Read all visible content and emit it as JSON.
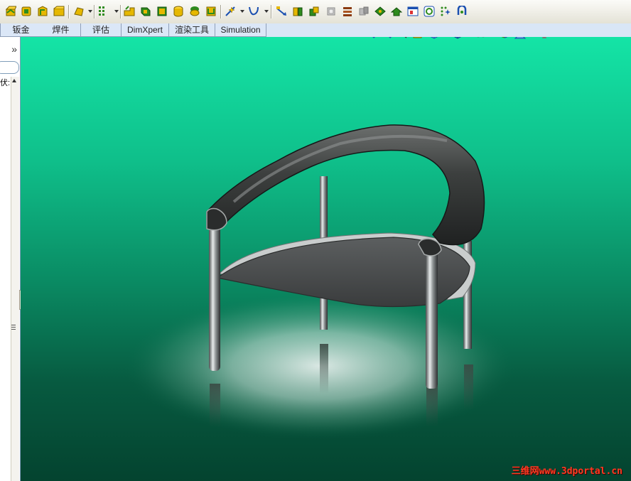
{
  "toolbar": {
    "icons": [
      {
        "name": "extruded-boss-icon",
        "color": "#e6b800"
      },
      {
        "name": "revolved-boss-icon",
        "color": "#e6b800"
      },
      {
        "name": "swept-boss-icon",
        "color": "#e6b800"
      },
      {
        "name": "lofted-boss-icon",
        "color": "#e6b800"
      },
      {
        "name": "boundary-boss-icon",
        "color": "#e6b800"
      },
      {
        "name": "extruded-cut-icon",
        "color": "#2e8b1e"
      },
      {
        "name": "revolved-cut-icon",
        "color": "#2e8b1e"
      },
      {
        "name": "fillet-icon",
        "color": "#e6b800"
      },
      {
        "name": "linear-pattern-icon",
        "color": "#2e8b1e"
      },
      {
        "name": "rib-icon",
        "color": "#e6b800"
      },
      {
        "name": "draft-icon",
        "color": "#e6b800"
      },
      {
        "name": "shell-icon",
        "color": "#e6b800"
      },
      {
        "name": "wrap-icon",
        "color": "#e6b800"
      },
      {
        "name": "reference-geometry-icon",
        "color": "#d4a000"
      },
      {
        "name": "curves-icon",
        "color": "#1a4fb0"
      },
      {
        "name": "instant3d-icon",
        "color": "#1a4fb0"
      }
    ]
  },
  "tabs": [
    "钣金",
    "焊件",
    "评估",
    "DimXpert",
    "渲染工具",
    "Simulation"
  ],
  "leftpanel": {
    "expander": "»",
    "tree_text": "伏:"
  },
  "hud": {
    "icons": [
      "zoom-to-fit-icon",
      "zoom-to-area-icon",
      "previous-view-icon",
      "section-view-icon",
      "view-orientation-icon",
      "display-style-icon",
      "hide-show-items-icon",
      "edit-appearance-icon",
      "apply-scene-icon",
      "view-settings-icon"
    ]
  },
  "watermark": {
    "cjk": "三维网",
    "url": "www.3dportal.cn"
  },
  "colors": {
    "background_top": "#14e4a6",
    "background_bottom": "#04432f",
    "chair_leather": "#3a3d3c",
    "chair_seat": "#4d4f50",
    "chrome": "#b8bcbd",
    "watermark": "#ff3a22"
  }
}
